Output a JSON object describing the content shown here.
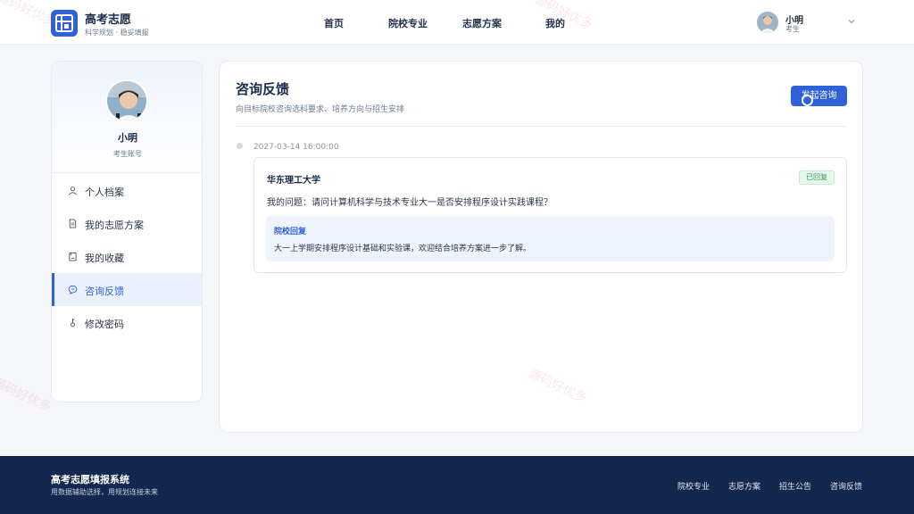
{
  "header": {
    "brand_title": "高考志愿",
    "brand_sub": "科学规划 · 稳妥填报",
    "nav": [
      {
        "label": "首页"
      },
      {
        "label": "院校专业"
      },
      {
        "label": "志愿方案"
      },
      {
        "label": "我的"
      }
    ],
    "user_name": "小明",
    "user_role": "考生"
  },
  "sidebar": {
    "name": "小明",
    "role": "考生账号",
    "items": [
      {
        "label": "个人档案",
        "icon": "user-icon"
      },
      {
        "label": "我的志愿方案",
        "icon": "document-icon"
      },
      {
        "label": "我的收藏",
        "icon": "bookmark-icon"
      },
      {
        "label": "咨询反馈",
        "icon": "chat-icon",
        "active": true
      },
      {
        "label": "修改密码",
        "icon": "key-icon"
      }
    ]
  },
  "main": {
    "title": "咨询反馈",
    "desc": "向目标院校咨询选科要求、培养方向与招生安排",
    "button_label": "发起咨询",
    "entries": [
      {
        "time": "2027-03-14 16:00:00",
        "school": "华东理工大学",
        "status": "已回复",
        "question": "我的问题：请问计算机科学与技术专业大一是否安排程序设计实践课程？",
        "reply_title": "院校回复",
        "reply_text": "大一上学期安排程序设计基础和实验课，欢迎结合培养方案进一步了解。"
      }
    ]
  },
  "footer": {
    "title": "高考志愿填报系统",
    "sub": "用数据辅助选择，用规划连接未来",
    "links": [
      {
        "label": "院校专业"
      },
      {
        "label": "志愿方案"
      },
      {
        "label": "招生公告"
      },
      {
        "label": "咨询反馈"
      }
    ]
  },
  "watermarks": {
    "text": "源码好优多"
  },
  "colors": {
    "accent": "#2f62d8",
    "footer_bg": "#14284f",
    "status_green": "#2f9e58"
  }
}
